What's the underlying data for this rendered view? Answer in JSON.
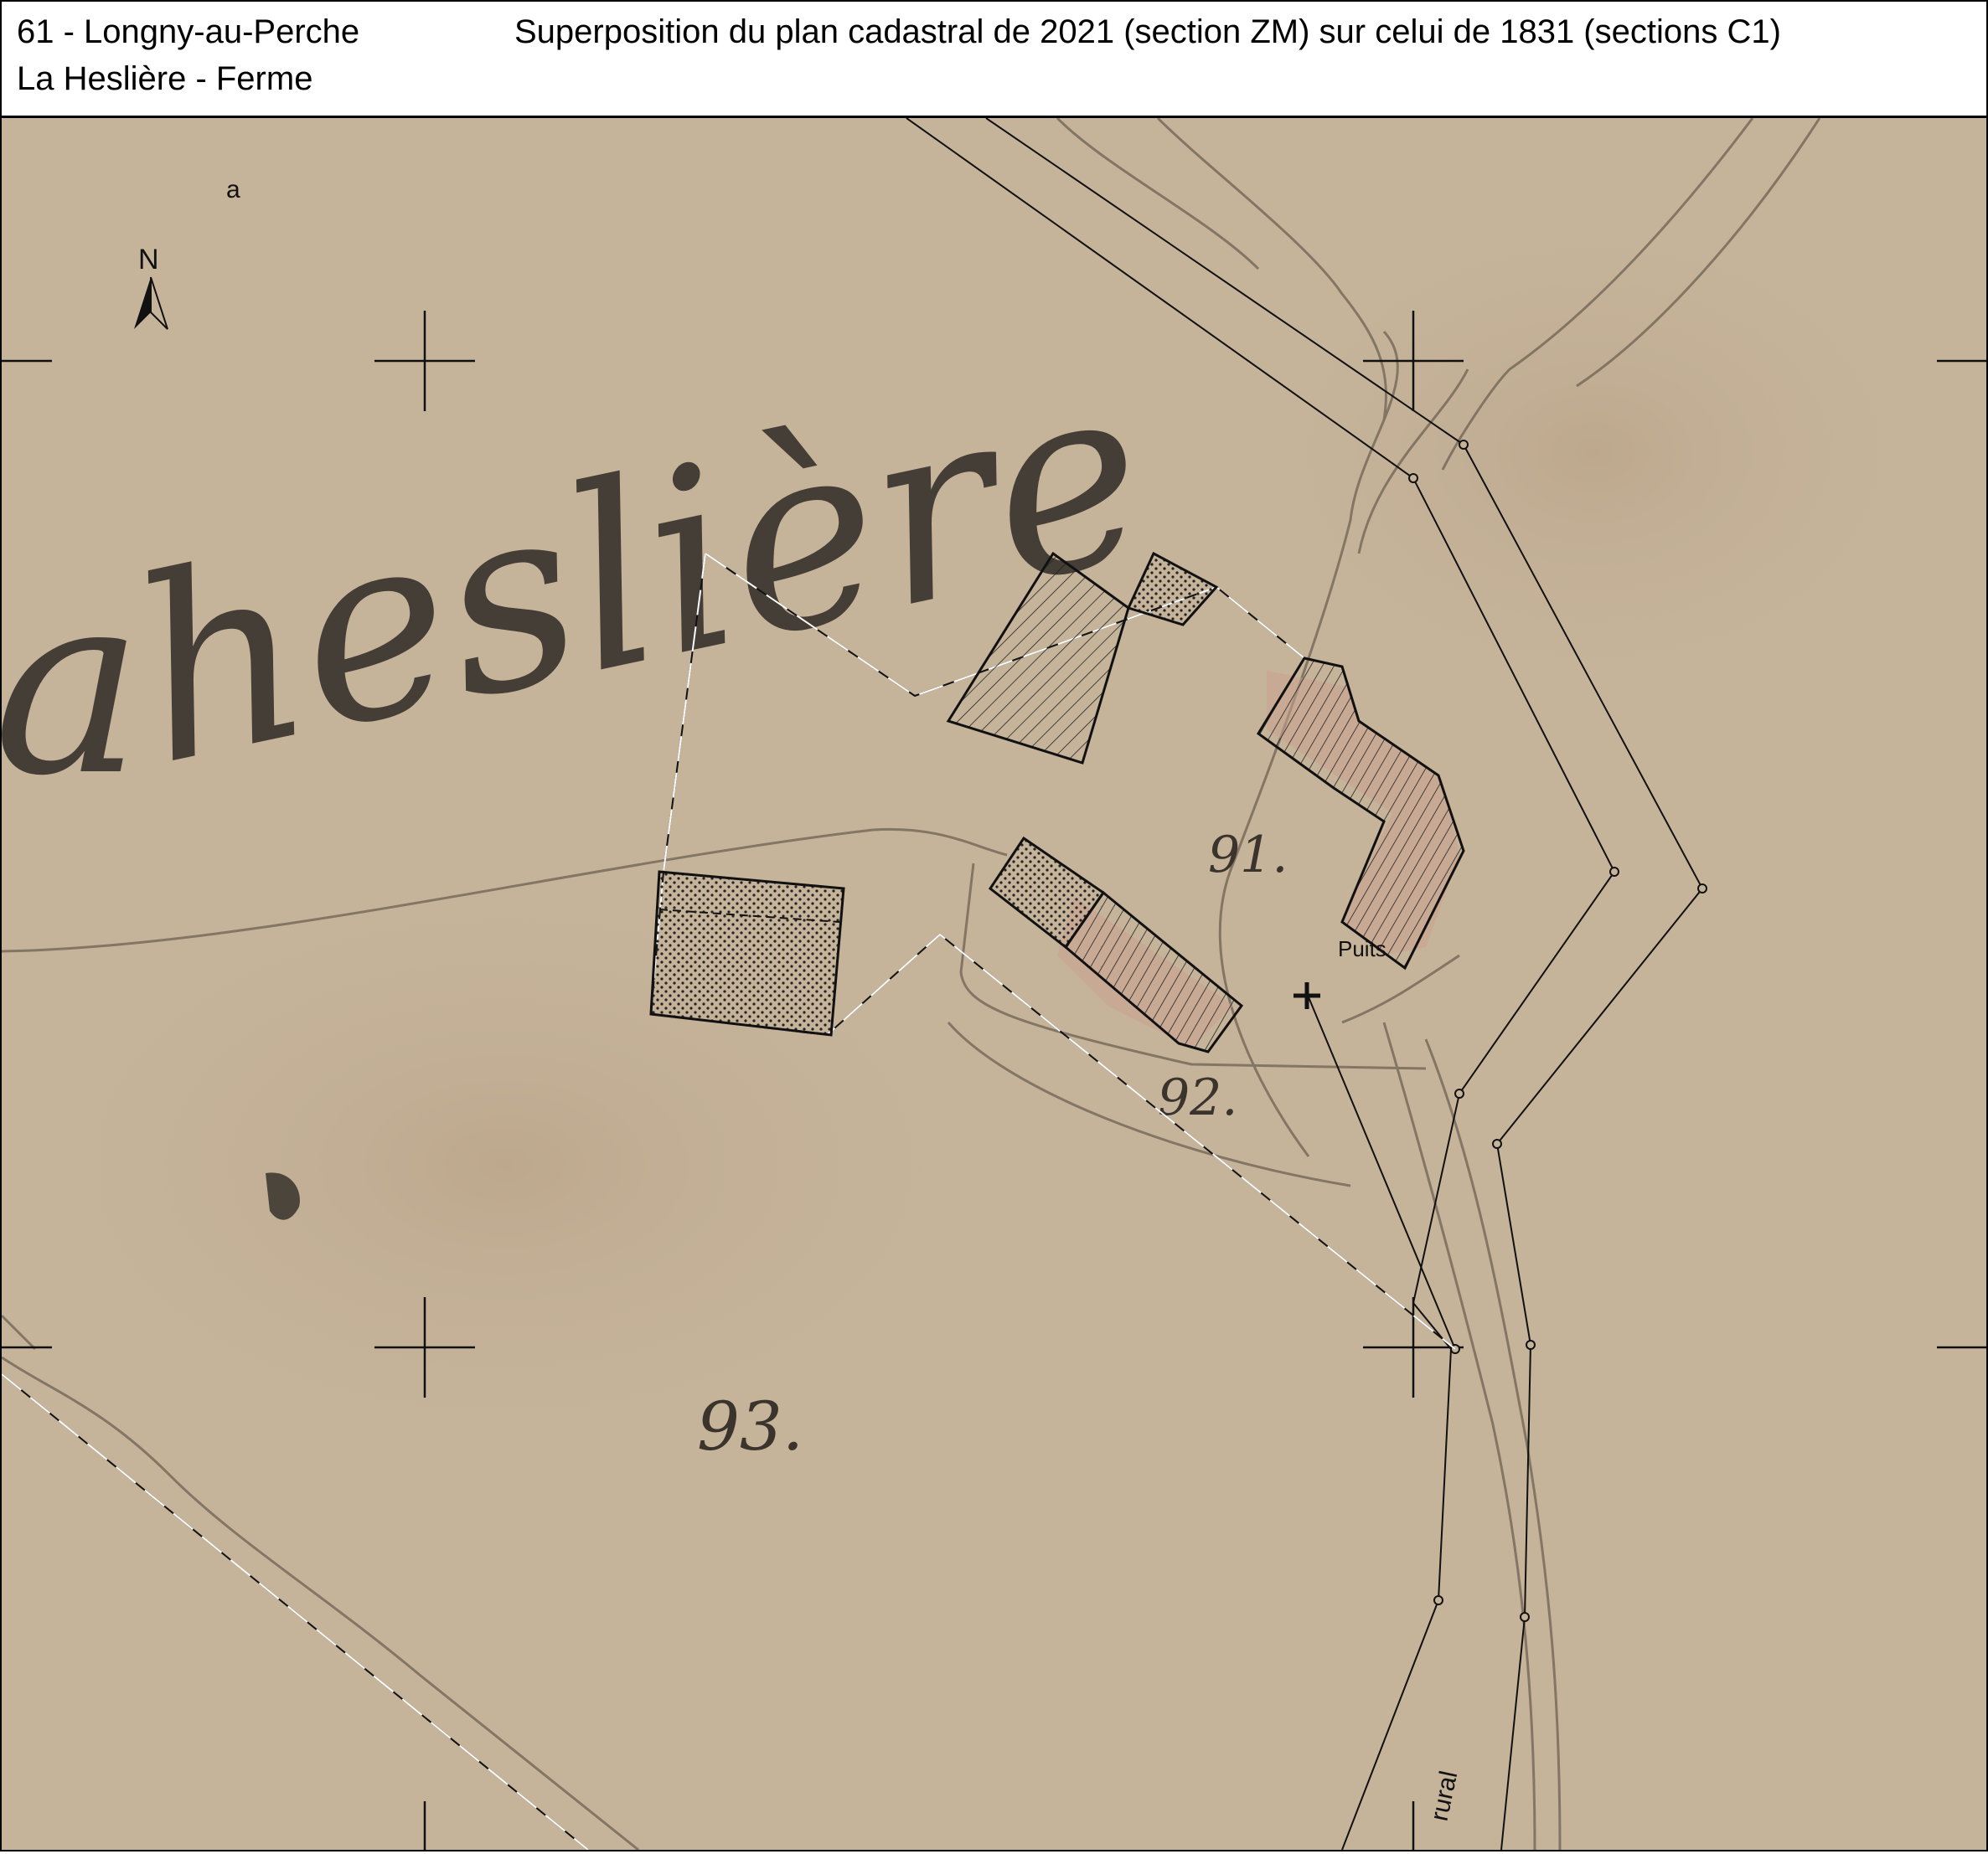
{
  "header": {
    "commune": "61 - Longny-au-Perche",
    "site": "La Heslière - Ferme",
    "title": "Superposition du plan cadastral de 2021 (section ZM) sur celui de 1831 (sections C1)"
  },
  "map": {
    "corner_mark": "a",
    "north_label": "N",
    "place_name_1831": "heslière",
    "place_name_prefix": "a",
    "parcels": {
      "p91": "91.",
      "p92": "92.",
      "p93": "93."
    },
    "well_label": "Puits",
    "road_label": "rural",
    "colors": {
      "paper": "#c5b39a",
      "ink": "#2e2a25",
      "hatch_pink": "#c9a090",
      "line": "#111111"
    }
  }
}
